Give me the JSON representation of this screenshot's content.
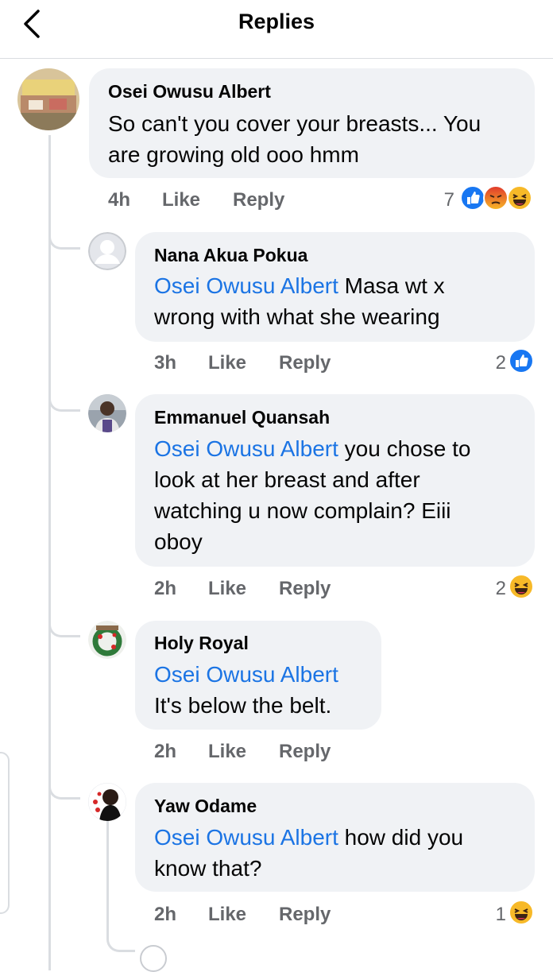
{
  "header": {
    "title": "Replies",
    "back_icon": "chevron-left-icon"
  },
  "comments": [
    {
      "author": "Osei Owusu Albert",
      "lines": [
        "So can't you cover your breasts... You",
        "are growing old ooo hmm"
      ],
      "time": "4h",
      "like": "Like",
      "reply": "Reply",
      "reaction_count": "7",
      "reactions": [
        "like",
        "angry",
        "haha"
      ]
    },
    {
      "author": "Nana Akua Pokua",
      "mention": "Osei Owusu Albert",
      "lines": [
        " Masa wt x",
        "wrong with what she wearing"
      ],
      "time": "3h",
      "like": "Like",
      "reply": "Reply",
      "reaction_count": "2",
      "reactions": [
        "like"
      ]
    },
    {
      "author": "Emmanuel Quansah",
      "mention": "Osei Owusu Albert",
      "lines": [
        " you chose to",
        "look at her breast and after",
        "watching u now complain? Eiii",
        "oboy"
      ],
      "time": "2h",
      "like": "Like",
      "reply": "Reply",
      "reaction_count": "2",
      "reactions": [
        "haha"
      ]
    },
    {
      "author": "Holy Royal",
      "mention": "Osei Owusu Albert",
      "lines": [
        "",
        "It's below the belt."
      ],
      "time": "2h",
      "like": "Like",
      "reply": "Reply"
    },
    {
      "author": "Yaw Odame",
      "mention": "Osei Owusu Albert",
      "lines": [
        " how did you",
        "know that?"
      ],
      "time": "2h",
      "like": "Like",
      "reply": "Reply",
      "reaction_count": "1",
      "reactions": [
        "haha"
      ]
    }
  ],
  "colors": {
    "mention": "#1b74e4",
    "bubble": "#f0f2f5",
    "like": "#1877f2",
    "angry": "#e9710f",
    "haha": "#f7b928",
    "meta": "#65676b"
  }
}
